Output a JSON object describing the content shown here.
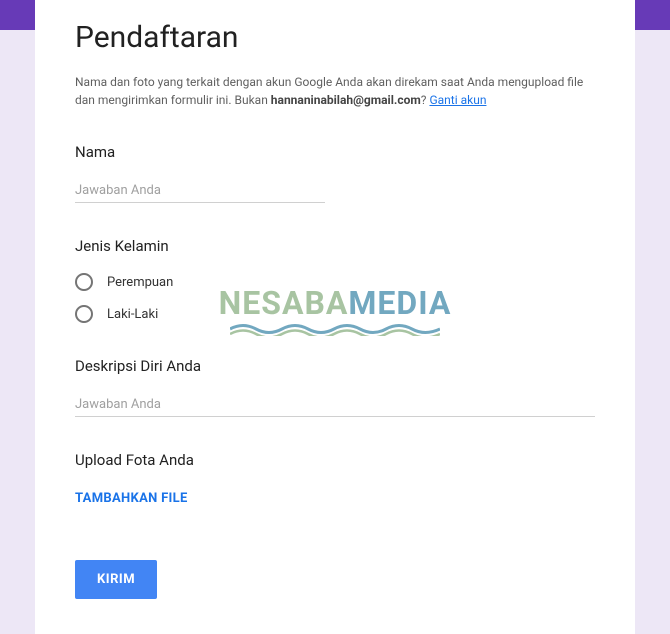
{
  "header": {
    "title": "Pendaftaran"
  },
  "description": {
    "text1": "Nama dan foto yang terkait dengan akun Google Anda akan direkam saat Anda mengupload file dan mengirimkan formulir ini. Bukan ",
    "email": "hannaninabilah@gmail.com",
    "text2": "? ",
    "switch_link": "Ganti akun"
  },
  "questions": {
    "nama": {
      "title": "Nama",
      "placeholder": "Jawaban Anda"
    },
    "jenis_kelamin": {
      "title": "Jenis Kelamin",
      "options": [
        {
          "label": "Perempuan"
        },
        {
          "label": "Laki-Laki"
        }
      ]
    },
    "deskripsi": {
      "title": "Deskripsi Diri Anda",
      "placeholder": "Jawaban Anda"
    },
    "upload": {
      "title": "Upload Fota Anda",
      "button": "TAMBAHKAN FILE"
    }
  },
  "submit": {
    "label": "KIRIM"
  },
  "watermark": {
    "part1": "NESABA",
    "part2": "MEDIA"
  }
}
